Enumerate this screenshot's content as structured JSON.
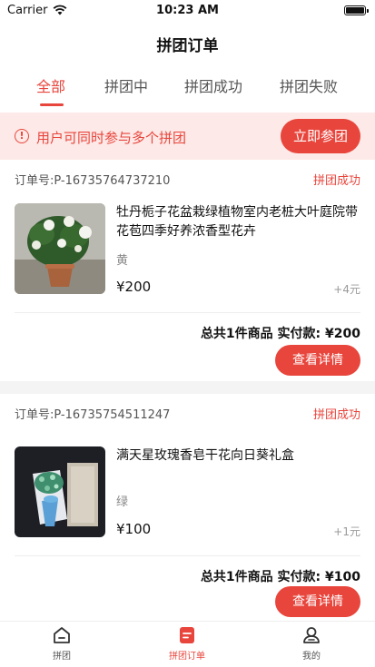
{
  "status_bar": {
    "carrier": "Carrier",
    "time": "10:23 AM"
  },
  "header": {
    "title": "拼团订单"
  },
  "tabs": [
    {
      "label": "全部",
      "active": true
    },
    {
      "label": "拼团中",
      "active": false
    },
    {
      "label": "拼团成功",
      "active": false
    },
    {
      "label": "拼团失败",
      "active": false
    }
  ],
  "banner": {
    "text": "用户可同时参与多个拼团",
    "button_label": "立即参团"
  },
  "orders": [
    {
      "order_no": "订单号:P-16735764737210",
      "status": "拼团成功",
      "title": "牡丹栀子花盆栽绿植物室内老桩大叶庭院带花苞四季好养浓香型花卉",
      "spec": "黄",
      "price": "¥200",
      "quantity": "+4元",
      "total": "总共1件商品 实付款: ¥200",
      "button_label": "查看详情",
      "image": "gardenia-plant-photo"
    },
    {
      "order_no": "订单号:P-16735754511247",
      "status": "拼团成功",
      "title": "满天星玫瑰香皂干花向日葵礼盒",
      "spec": "绿",
      "price": "¥100",
      "quantity": "+1元",
      "total": "总共1件商品 实付款: ¥100",
      "button_label": "查看详情",
      "image": "flower-gift-box-photo"
    }
  ],
  "tab_bar": [
    {
      "label": "拼团",
      "icon": "home-icon",
      "active": false
    },
    {
      "label": "拼团订单",
      "icon": "order-icon",
      "active": true
    },
    {
      "label": "我的",
      "icon": "profile-icon",
      "active": false
    }
  ],
  "colors": {
    "accent": "#e8453c",
    "banner_bg": "#fde9e7"
  }
}
